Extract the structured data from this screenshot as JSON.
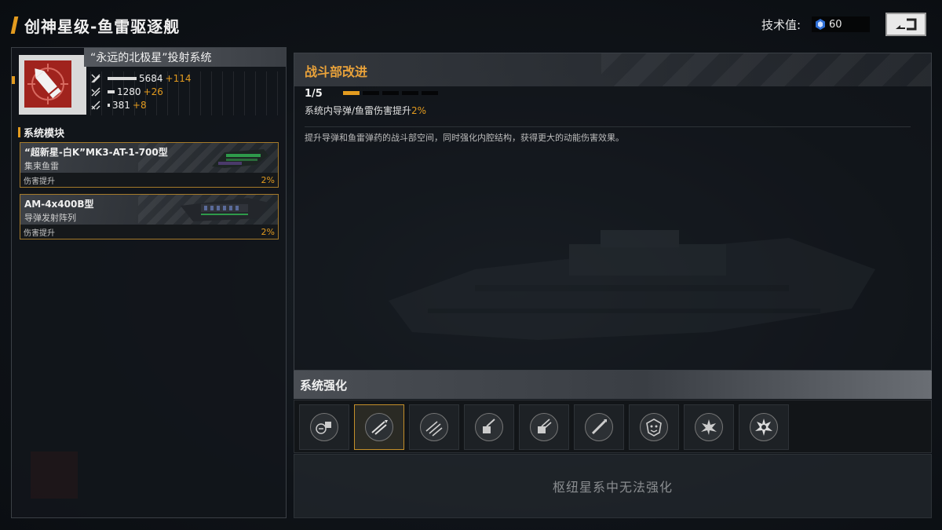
{
  "header": {
    "title": "创神星级-鱼雷驱逐舰",
    "tech_label": "技术值:",
    "tech_value": "60"
  },
  "system": {
    "name": "“永远的北极星”投射系统",
    "stats": [
      {
        "icon": "damage-stat-icon",
        "value": "5684",
        "bonus": "+114",
        "level": 0.78
      },
      {
        "icon": "penetration-stat-icon",
        "value": "1280",
        "bonus": "+26",
        "level": 0.18
      },
      {
        "icon": "range-stat-icon",
        "value": "381",
        "bonus": "+8",
        "level": 0.06
      }
    ]
  },
  "modules": {
    "section_title": "系统模块",
    "items": [
      {
        "name": "“超新星-白K”MK3-AT-1-700型",
        "type": "集束鱼雷",
        "effect": "伤害提升",
        "pct": "2%"
      },
      {
        "name": "AM-4x400B型",
        "type": "导弹发射阵列",
        "effect": "伤害提升",
        "pct": "2%"
      }
    ]
  },
  "detail": {
    "title": "战斗部改进",
    "level": "1/5",
    "level_current": 1,
    "level_max": 5,
    "upgrade_text": "系统内导弹/鱼雷伤害提升",
    "upgrade_pct": "2%",
    "description": "提升导弹和鱼雷弹药的战斗部空间，同时强化内腔结构，获得更大的动能伤害效果。"
  },
  "enhance": {
    "title": "系统强化",
    "slots": [
      {
        "icon": "ammo-capacity-icon",
        "selected": false
      },
      {
        "icon": "warhead-upgrade-icon",
        "selected": true
      },
      {
        "icon": "missile-cluster-icon",
        "selected": false
      },
      {
        "icon": "launcher-upgrade-icon",
        "selected": false
      },
      {
        "icon": "launcher-rate-icon",
        "selected": false
      },
      {
        "icon": "single-missile-icon",
        "selected": false
      },
      {
        "icon": "beast-emblem-icon",
        "selected": false
      },
      {
        "icon": "explosion-icon",
        "selected": false
      },
      {
        "icon": "explosion-burst-icon",
        "selected": false
      }
    ],
    "locked_text": "枢纽星系中无法强化"
  },
  "colors": {
    "accent": "#e39b1f",
    "alert_red": "#a0231d"
  }
}
